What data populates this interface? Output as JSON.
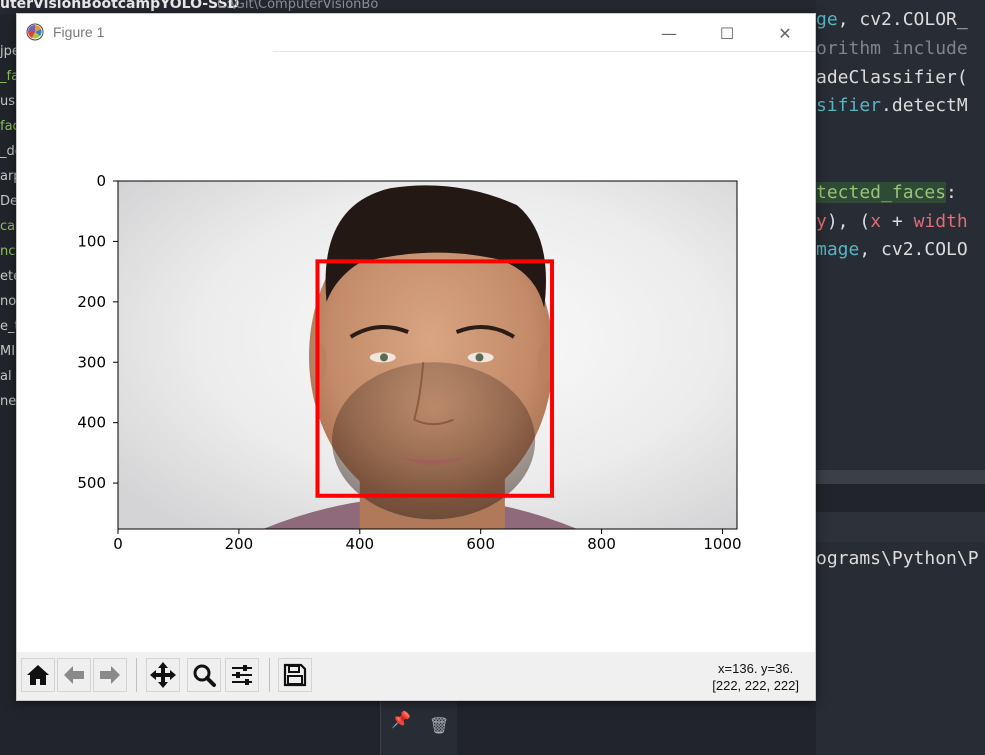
{
  "ide": {
    "title": "uterVisionBootcampYOLO-SSD",
    "path": "C:\\Git\\ComputerVisionBo",
    "files": [
      {
        "label": "jpe",
        "green": false
      },
      {
        "label": "_fa",
        "green": true
      },
      {
        "label": "us,",
        "green": false
      },
      {
        "label": "fac",
        "green": true
      },
      {
        "label": "_de",
        "green": false
      },
      {
        "label": "arp",
        "green": false
      },
      {
        "label": "Det",
        "green": false
      },
      {
        "label": "cas",
        "green": true
      },
      {
        "label": "ncv",
        "green": true
      },
      {
        "label": "ete",
        "green": false
      },
      {
        "label": "nor",
        "green": false
      },
      {
        "label": "e_t",
        "green": false
      },
      {
        "label": "MI",
        "green": false
      },
      {
        "label": "al L",
        "green": false
      },
      {
        "label": "nes",
        "green": false
      }
    ],
    "code": {
      "l1a": "ge",
      "l1b": ", cv2.COLOR_",
      "l2": "orithm include",
      "l3": "adeClassifier(",
      "l4a": "sifier",
      "l4b": ".detectM",
      "l5a": "tected_faces",
      "l5b": ":",
      "l6a": "y",
      "l6b": "), (",
      "l6c": "x",
      "l6d": " + ",
      "l6e": "width",
      "l7a": "mage",
      "l7b": ", cv2.COLO"
    },
    "terminal_text": "ograms\\Python\\P"
  },
  "window": {
    "title": "Figure 1",
    "minimize_glyph": "—",
    "maximize_glyph": "☐",
    "close_glyph": "✕"
  },
  "status": {
    "coords": "x=136. y=36.",
    "pixel": "[222, 222, 222]"
  },
  "chart_data": {
    "type": "image",
    "title": "",
    "xlabel": "",
    "ylabel": "",
    "xlim": [
      0,
      1024
    ],
    "ylim": [
      576,
      0
    ],
    "xticks": [
      0,
      200,
      400,
      600,
      800,
      1000
    ],
    "yticks": [
      0,
      100,
      200,
      300,
      400,
      500
    ],
    "box_color": "#ff0000",
    "face_box": {
      "x0": 330,
      "y0": 133,
      "x1": 718,
      "y1": 521
    }
  },
  "colors": {
    "face_box": "#ff0000",
    "toolbar_bg": "#f0f0f0"
  }
}
